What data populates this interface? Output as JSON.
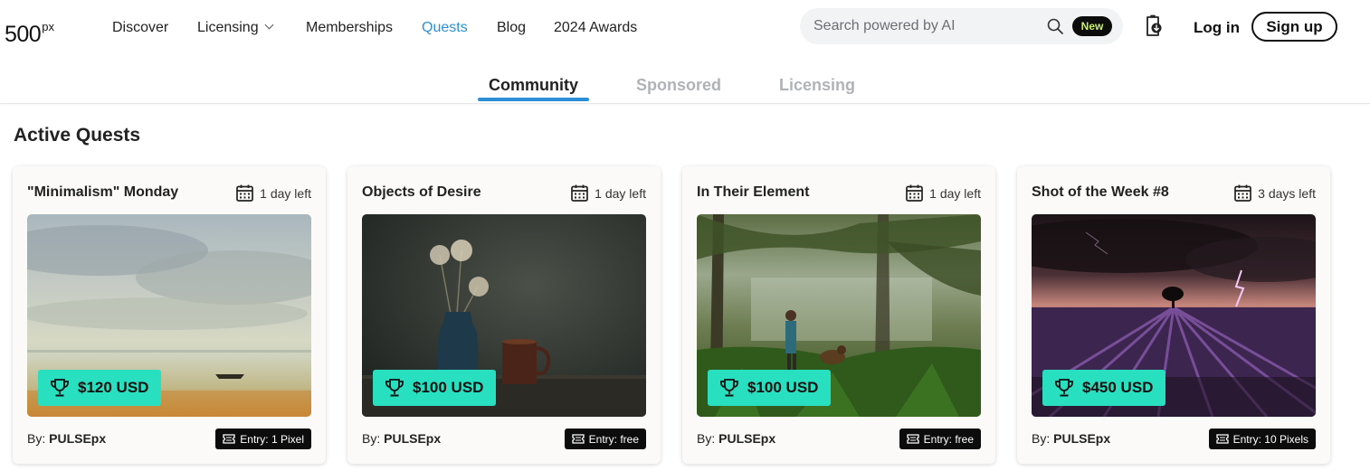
{
  "brand": {
    "logo_text": "500",
    "logo_sup": "px"
  },
  "nav": {
    "items": [
      {
        "label": "Discover"
      },
      {
        "label": "Licensing"
      },
      {
        "label": "Memberships"
      },
      {
        "label": "Quests"
      },
      {
        "label": "Blog"
      },
      {
        "label": "2024 Awards"
      }
    ],
    "active": "Quests",
    "search_placeholder": "Search powered by AI",
    "search_value": "",
    "new_badge": "New",
    "login_label": "Log in",
    "signup_label": "Sign up",
    "icons": {
      "search": "search-icon",
      "upload": "upload-icon",
      "licensing_dropdown": "chevron-down-icon"
    }
  },
  "tabs": {
    "items": [
      {
        "label": "Community"
      },
      {
        "label": "Sponsored"
      },
      {
        "label": "Licensing"
      }
    ],
    "active": "Community"
  },
  "section": {
    "title": "Active Quests"
  },
  "quests": [
    {
      "title": "\"Minimalism\" Monday",
      "time_left": "1 day left",
      "prize": "$120 USD",
      "by_label": "By:",
      "author": "PULSEpx",
      "entry": "Entry: 1 Pixel"
    },
    {
      "title": "Objects of Desire",
      "time_left": "1 day left",
      "prize": "$100 USD",
      "by_label": "By:",
      "author": "PULSEpx",
      "entry": "Entry: free"
    },
    {
      "title": "In Their Element",
      "time_left": "1 day left",
      "prize": "$100 USD",
      "by_label": "By:",
      "author": "PULSEpx",
      "entry": "Entry: free"
    },
    {
      "title": "Shot of the Week #8",
      "time_left": "3 days left",
      "prize": "$450 USD",
      "by_label": "By:",
      "author": "PULSEpx",
      "entry": "Entry: 10 Pixels"
    }
  ],
  "colors": {
    "accent_blue": "#2c8fd6",
    "prize_teal": "#28e0c0",
    "new_badge_text": "#c9ef6a",
    "inactive_tab": "#b0b3b6"
  }
}
